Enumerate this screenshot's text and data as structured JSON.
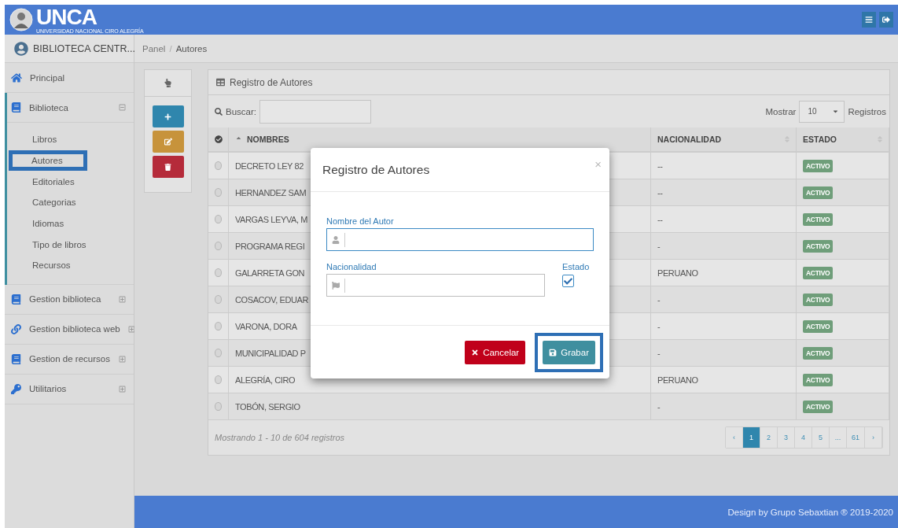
{
  "header": {
    "logo_text": "UNCA",
    "logo_subtext": "UNIVERSIDAD NACIONAL CIRO ALEGRÍA",
    "actions": [
      {
        "kind": "menu"
      },
      {
        "kind": "logout"
      }
    ]
  },
  "sidebar": {
    "user": "BIBLIOTECA CENTR...",
    "items": [
      {
        "label": "Principal",
        "kind": "link"
      },
      {
        "label": "Biblioteca",
        "kind": "group",
        "expanded": true,
        "children": [
          {
            "label": "Libros",
            "selected": false
          },
          {
            "label": "Autores",
            "selected": true
          },
          {
            "label": "Editoriales",
            "selected": false
          },
          {
            "label": "Categorias",
            "selected": false
          },
          {
            "label": "Idiomas",
            "selected": false
          },
          {
            "label": "Tipo de libros",
            "selected": false
          },
          {
            "label": "Recursos",
            "selected": false
          }
        ]
      },
      {
        "label": "Gestion biblioteca",
        "kind": "group",
        "expanded": false
      },
      {
        "label": "Gestion biblioteca web",
        "kind": "group",
        "expanded": false
      },
      {
        "label": "Gestion de recursos",
        "kind": "group",
        "expanded": false
      },
      {
        "label": "Utilitarios",
        "kind": "group",
        "expanded": false
      }
    ]
  },
  "breadcrumb": {
    "items": [
      "Panel",
      "Autores"
    ],
    "separator": "/"
  },
  "toolbar": [
    {
      "kind": "pointer"
    },
    {
      "kind": "add"
    },
    {
      "kind": "edit"
    },
    {
      "kind": "delete"
    }
  ],
  "table": {
    "title": "Registro de Autores",
    "search_label": "Buscar:",
    "show_label": "Mostrar",
    "page_size": "10",
    "show_suffix": "Registros",
    "columns": [
      {
        "label": "NOMBRES",
        "sorted": true
      },
      {
        "label": "NACIONALIDAD",
        "sorted": false
      },
      {
        "label": "ESTADO",
        "sorted": false
      }
    ],
    "rows": [
      {
        "name": "DECRETO LEY 82",
        "nationality": "--",
        "status": "ACTIVO",
        "selected": false
      },
      {
        "name": "HERNANDEZ SAM",
        "nationality": "--",
        "status": "ACTIVO",
        "selected": false
      },
      {
        "name": "VARGAS LEYVA, M",
        "nationality": "--",
        "status": "ACTIVO",
        "selected": false
      },
      {
        "name": "PROGRAMA REGI",
        "nationality": "-",
        "status": "ACTIVO",
        "selected": false
      },
      {
        "name": "GALARRETA GON",
        "nationality": "PERUANO",
        "status": "ACTIVO",
        "selected": false
      },
      {
        "name": "COSACOV, EDUAR",
        "nationality": "-",
        "status": "ACTIVO",
        "selected": false
      },
      {
        "name": "VARONA, DORA",
        "nationality": "-",
        "status": "ACTIVO",
        "selected": false
      },
      {
        "name": "MUNICIPALIDAD P",
        "nationality": "-",
        "status": "ACTIVO",
        "selected": false
      },
      {
        "name": "ALEGRÍA, CIRO",
        "nationality": "PERUANO",
        "status": "ACTIVO",
        "selected": false
      },
      {
        "name": "TOBÓN, SERGIO",
        "nationality": "-",
        "status": "ACTIVO",
        "selected": false
      }
    ],
    "info": "Mostrando 1 - 10 de 604 registros",
    "pagination": [
      {
        "label": "‹",
        "selected": false
      },
      {
        "label": "1",
        "selected": true
      },
      {
        "label": "2",
        "selected": false
      },
      {
        "label": "3",
        "selected": false
      },
      {
        "label": "4",
        "selected": false
      },
      {
        "label": "5",
        "selected": false
      },
      {
        "label": "...",
        "selected": false
      },
      {
        "label": "61",
        "selected": false
      },
      {
        "label": "›",
        "selected": false
      }
    ]
  },
  "modal": {
    "title": "Registro de Autores",
    "close": "×",
    "fields": [
      {
        "label": "Nombre del Autor",
        "focused": true
      },
      {
        "label": "Nacionalidad",
        "focused": false
      }
    ],
    "checkbox": {
      "label": "Estado",
      "checked": true
    },
    "buttons": [
      {
        "label": "Cancelar",
        "kind": "cancel",
        "highlighted": false
      },
      {
        "label": "Grabar",
        "kind": "save",
        "highlighted": true
      }
    ]
  },
  "footer": "Design by Grupo Sebaxtian ® 2019-2020"
}
